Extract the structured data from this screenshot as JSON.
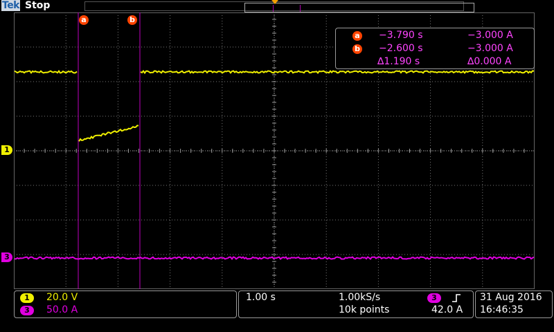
{
  "header": {
    "brand": "Tek",
    "state": "Stop"
  },
  "cursors": {
    "a_label": "a",
    "b_label": "b"
  },
  "readout": {
    "a_label": "a",
    "a_time": "−3.790 s",
    "a_value": "−3.000 A",
    "b_label": "b",
    "b_time": "−2.600 s",
    "b_value": "−3.000 A",
    "delta_time": "∆1.190 s",
    "delta_value": "∆0.000 A"
  },
  "channels": {
    "ch1": {
      "marker": "1",
      "scale": "20.0 V",
      "color": "#f0f000"
    },
    "ch3": {
      "marker": "3",
      "scale": "50.0 A",
      "color": "#e000e0"
    }
  },
  "timebase": {
    "scale": "1.00 s",
    "sample_rate": "1.00kS/s",
    "record_length": "10k points",
    "trigger_source": "3",
    "trigger_slope_icon": "rising-edge-icon",
    "trigger_level": "42.0 A"
  },
  "datetime": {
    "date": "31 Aug 2016",
    "time": "16:46:35"
  },
  "colors": {
    "cursor": "#c000c0",
    "grid": "#7a7a7a",
    "trigger": "#f5a000",
    "cursor_badge": "#ff4400"
  }
}
